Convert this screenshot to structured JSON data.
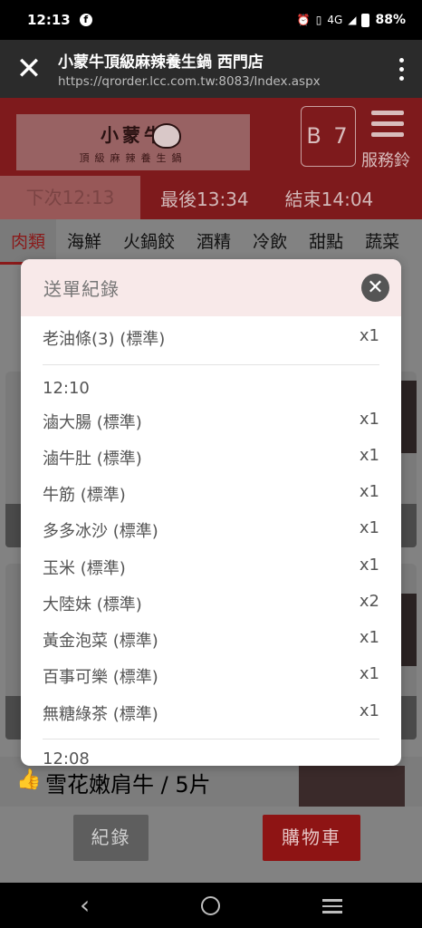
{
  "status_bar": {
    "time": "12:13",
    "app_icon": "f",
    "signal": "4G",
    "battery": "88%"
  },
  "browser": {
    "title": "小蒙牛頂級麻辣養生鍋 西門店",
    "url": "https://qrorder.lcc.com.tw:8083/Index.aspx",
    "close_icon": "close-icon",
    "menu_icon": "kebab-menu-icon"
  },
  "header": {
    "logo_title": "小蒙牛",
    "logo_sub": "頂級麻辣養生鍋",
    "table_no": "B 7",
    "service_label": "服務鈴"
  },
  "times": {
    "next": "下次12:13",
    "last": "最後13:34",
    "end": "結束14:04"
  },
  "categories": [
    "肉類",
    "海鮮",
    "火鍋餃",
    "酒精",
    "冷飲",
    "甜點",
    "蔬菜"
  ],
  "background_item": {
    "name": "雪花嫩肩牛 / 5片"
  },
  "buttons": {
    "record": "紀錄",
    "cart": "購物車"
  },
  "modal": {
    "title": "送單紀錄",
    "top_item": {
      "name": "老油條(3) (標準)",
      "qty": "x1"
    },
    "groups": [
      {
        "time": "12:10",
        "items": [
          {
            "name": "滷大腸 (標準)",
            "qty": "x1"
          },
          {
            "name": "滷牛肚 (標準)",
            "qty": "x1"
          },
          {
            "name": "牛筋 (標準)",
            "qty": "x1"
          },
          {
            "name": "多多冰沙 (標準)",
            "qty": "x1"
          },
          {
            "name": "玉米 (標準)",
            "qty": "x1"
          },
          {
            "name": "大陸妹 (標準)",
            "qty": "x2"
          },
          {
            "name": "黃金泡菜 (標準)",
            "qty": "x1"
          },
          {
            "name": "百事可樂 (標準)",
            "qty": "x1"
          },
          {
            "name": "無糖綠茶 (標準)",
            "qty": "x1"
          }
        ]
      },
      {
        "time": "12:08",
        "items": []
      }
    ]
  },
  "colors": {
    "brand_red": "#8e1414",
    "header_red": "#7e1a1c",
    "modal_header": "#f8e9e9"
  }
}
